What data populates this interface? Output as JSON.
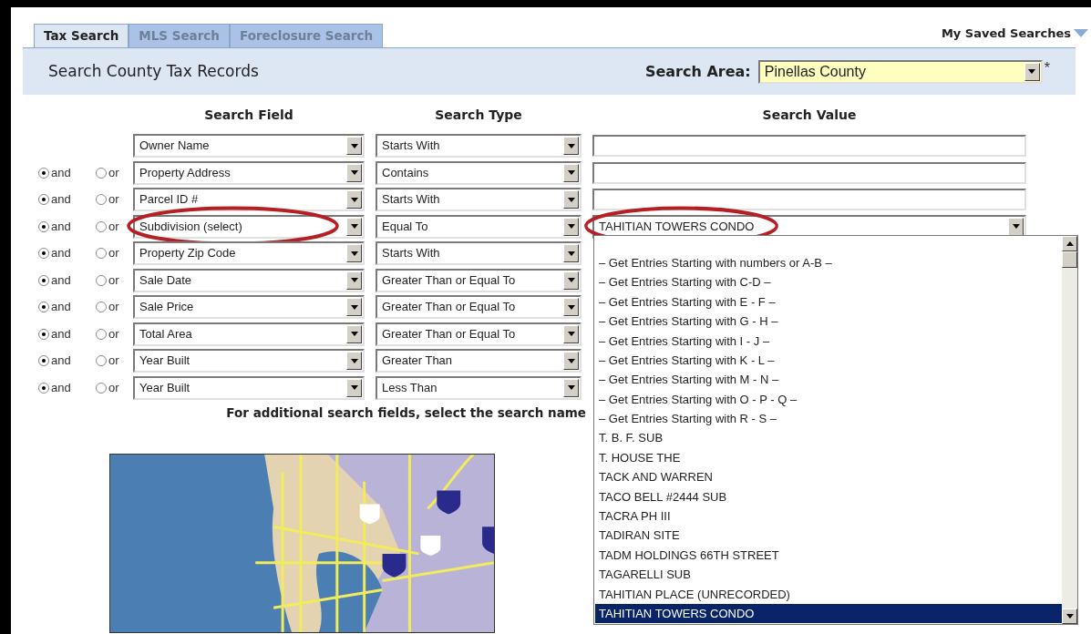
{
  "tabs": [
    {
      "label": "Tax Search",
      "selected": true
    },
    {
      "label": "MLS Search",
      "selected": false
    },
    {
      "label": "Foreclosure Search",
      "selected": false
    }
  ],
  "saved_searches": {
    "label": "My Saved Searches"
  },
  "header": {
    "title": "Search County Tax Records",
    "area_label": "Search Area:",
    "area_value": "Pinellas County",
    "required_mark": "*"
  },
  "columns": [
    "Search Field",
    "Search Type",
    "Search Value"
  ],
  "rows": [
    {
      "field": "Owner Name",
      "type": "Starts With",
      "value": {
        "kind": "text"
      },
      "highlighted": false
    },
    {
      "connectors": [
        {
          "label": "and",
          "selected": true
        },
        {
          "label": "or",
          "selected": false
        }
      ],
      "field": "Property Address",
      "type": "Contains",
      "value": {
        "kind": "text"
      },
      "highlighted": false
    },
    {
      "connectors": [
        {
          "label": "and",
          "selected": true
        },
        {
          "label": "or",
          "selected": false
        }
      ],
      "field": "Parcel ID #",
      "type": "Starts With",
      "value": {
        "kind": "text"
      },
      "highlighted": false
    },
    {
      "connectors": [
        {
          "label": "and",
          "selected": true
        },
        {
          "label": "or",
          "selected": false
        }
      ],
      "field": "Subdivision (select)",
      "type": "Equal To",
      "value": {
        "kind": "select",
        "text": "TAHITIAN TOWERS CONDO"
      },
      "highlighted": true
    },
    {
      "connectors": [
        {
          "label": "and",
          "selected": true
        },
        {
          "label": "or",
          "selected": false
        }
      ],
      "field": "Property Zip Code",
      "type": "Starts With",
      "highlighted": false
    },
    {
      "connectors": [
        {
          "label": "and",
          "selected": true
        },
        {
          "label": "or",
          "selected": false
        }
      ],
      "field": "Sale Date",
      "type": "Greater Than or Equal To",
      "highlighted": false
    },
    {
      "connectors": [
        {
          "label": "and",
          "selected": true
        },
        {
          "label": "or",
          "selected": false
        }
      ],
      "field": "Sale Price",
      "type": "Greater Than or Equal To",
      "highlighted": false
    },
    {
      "connectors": [
        {
          "label": "and",
          "selected": true
        },
        {
          "label": "or",
          "selected": false
        }
      ],
      "field": "Total Area",
      "type": "Greater Than or Equal To",
      "highlighted": false
    },
    {
      "connectors": [
        {
          "label": "and",
          "selected": true
        },
        {
          "label": "or",
          "selected": false
        }
      ],
      "field": "Year Built",
      "type": "Greater Than",
      "highlighted": false
    },
    {
      "connectors": [
        {
          "label": "and",
          "selected": true
        },
        {
          "label": "or",
          "selected": false
        }
      ],
      "field": "Year Built",
      "type": "Less Than",
      "highlighted": false
    }
  ],
  "footer_note": "For additional search fields, select the search name",
  "dropdown_list": {
    "items": [
      {
        "label": "– Get Entries Starting with numbers or A-B –",
        "selected": false
      },
      {
        "label": "– Get Entries Starting with C-D –",
        "selected": false
      },
      {
        "label": "– Get Entries Starting with E - F –",
        "selected": false
      },
      {
        "label": "– Get Entries Starting with G - H –",
        "selected": false
      },
      {
        "label": "– Get Entries Starting with I - J –",
        "selected": false
      },
      {
        "label": "– Get Entries Starting with K - L –",
        "selected": false
      },
      {
        "label": "– Get Entries Starting with M - N –",
        "selected": false
      },
      {
        "label": "– Get Entries Starting with O - P - Q –",
        "selected": false
      },
      {
        "label": "– Get Entries Starting with R - S –",
        "selected": false
      },
      {
        "label": "T. B. F. SUB",
        "selected": false
      },
      {
        "label": "T. HOUSE THE",
        "selected": false
      },
      {
        "label": "TACK AND WARREN",
        "selected": false
      },
      {
        "label": "TACO BELL #2444 SUB",
        "selected": false
      },
      {
        "label": "TACRA PH III",
        "selected": false
      },
      {
        "label": "TADIRAN SITE",
        "selected": false
      },
      {
        "label": "TADM HOLDINGS 66TH STREET",
        "selected": false
      },
      {
        "label": "TAGARELLI SUB",
        "selected": false
      },
      {
        "label": "TAHITIAN PLACE (UNRECORDED)",
        "selected": false
      },
      {
        "label": "TAHITIAN TOWERS CONDO",
        "selected": true
      }
    ]
  }
}
